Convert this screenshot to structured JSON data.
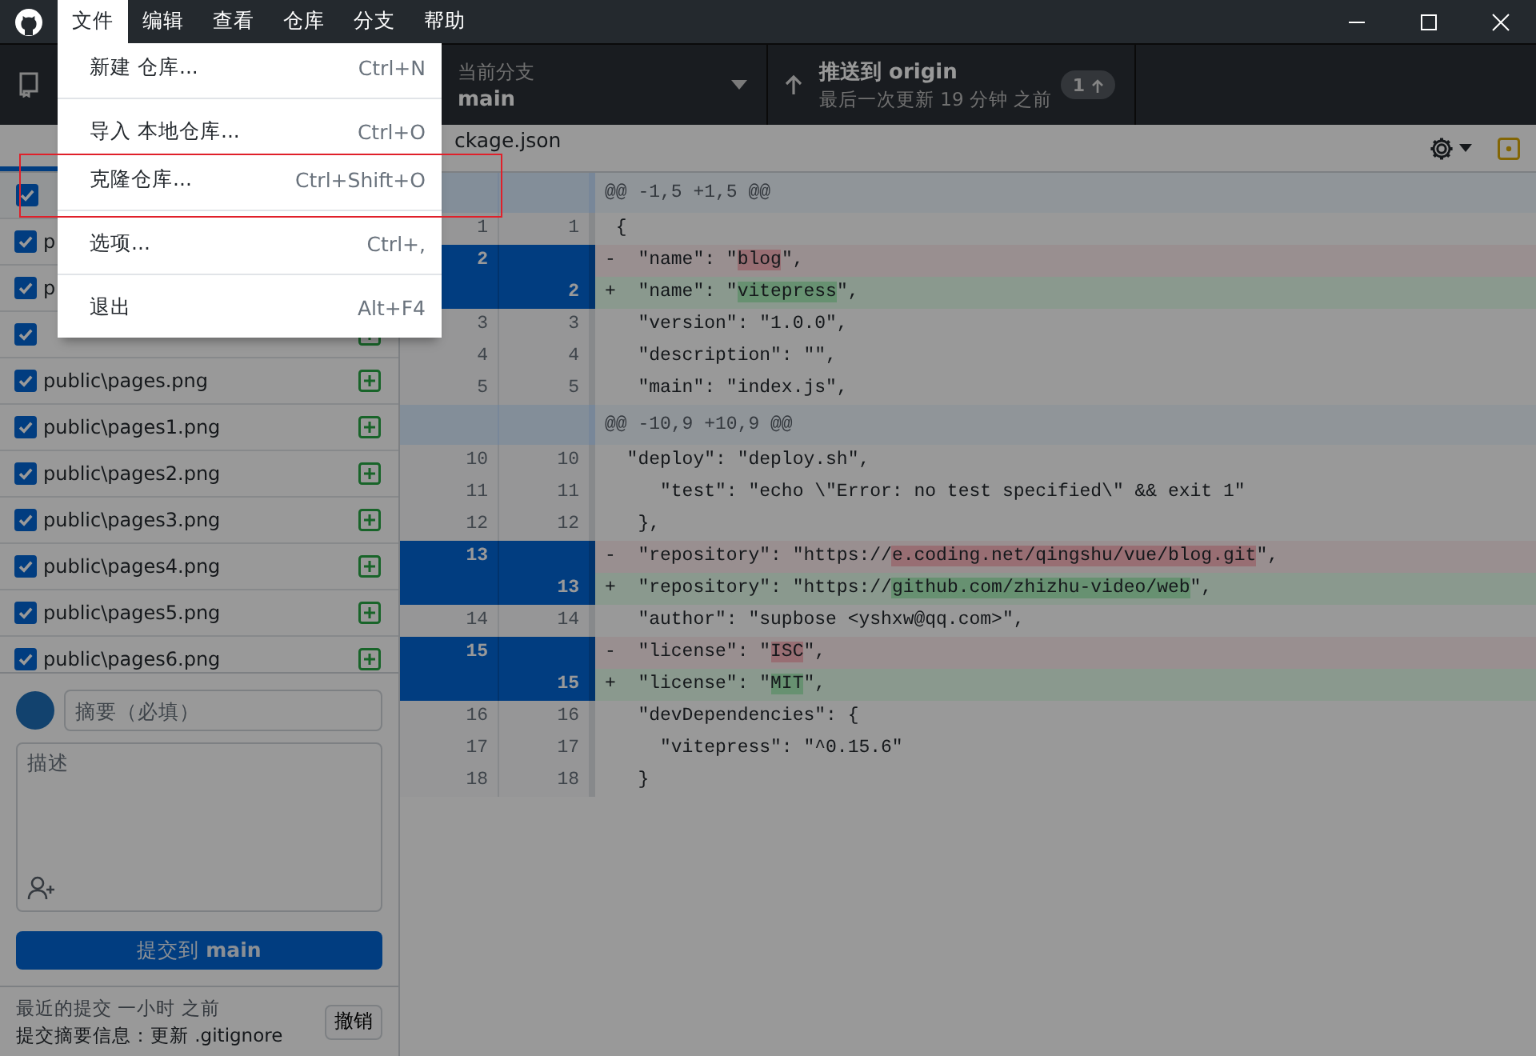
{
  "menubar": [
    {
      "label": "文件",
      "selected": true
    },
    {
      "label": "编辑",
      "selected": false
    },
    {
      "label": "查看",
      "selected": false
    },
    {
      "label": "仓库",
      "selected": false
    },
    {
      "label": "分支",
      "selected": false
    },
    {
      "label": "帮助",
      "selected": false
    }
  ],
  "toolbar": {
    "branch": {
      "label": "当前分支",
      "value": "main"
    },
    "push": {
      "title": "推送到 origin",
      "subtitle": "最后一次更新 19 分钟 之前",
      "badge": "1"
    }
  },
  "changes": {
    "all_checked": true,
    "files": [
      {
        "name": "p",
        "checked": true
      },
      {
        "name": "p",
        "checked": true
      },
      {
        "checked": true,
        "kind": "added"
      },
      {
        "name": "public\\pages.png",
        "checked": true,
        "kind": "added"
      },
      {
        "name": "public\\pages1.png",
        "checked": true,
        "kind": "added"
      },
      {
        "name": "public\\pages2.png",
        "checked": true,
        "kind": "added"
      },
      {
        "name": "public\\pages3.png",
        "checked": true,
        "kind": "added"
      },
      {
        "name": "public\\pages4.png",
        "checked": true,
        "kind": "added"
      },
      {
        "name": "public\\pages5.png",
        "checked": true,
        "kind": "added"
      },
      {
        "name": "public\\pages6.png",
        "checked": true,
        "kind": "added"
      }
    ]
  },
  "commit": {
    "summary_placeholder": "摘要（必填）",
    "description_placeholder": "描述",
    "button": "提交到 **main**"
  },
  "last_commit": {
    "time": "最近的提交 一小时 之前",
    "message": "提交摘要信息：更新 .gitignore",
    "undo": "撤销"
  },
  "diff": {
    "file": "ckage.json",
    "lines": [
      {
        "kind": "hunk",
        "parts": [
          {
            "text": "@@ -1,5 +1,5 @@"
          }
        ]
      },
      {
        "kind": "context",
        "old": "1",
        "new": "1",
        "parts": [
          {
            "text": " {"
          }
        ]
      },
      {
        "kind": "del",
        "old": "2",
        "selected": true,
        "parts": [
          {
            "text": "-  \"name\": \""
          },
          {
            "text": "blog",
            "changed": true
          },
          {
            "text": "\","
          }
        ]
      },
      {
        "kind": "add",
        "new": "2",
        "selected": true,
        "parts": [
          {
            "text": "+  \"name\": \""
          },
          {
            "text": "vitepress",
            "changed": true
          },
          {
            "text": "\","
          }
        ]
      },
      {
        "kind": "context",
        "old": "3",
        "new": "3",
        "parts": [
          {
            "text": "   \"version\": \"1.0.0\","
          }
        ]
      },
      {
        "kind": "context",
        "old": "4",
        "new": "4",
        "parts": [
          {
            "text": "   \"description\": \"\","
          }
        ]
      },
      {
        "kind": "context",
        "old": "5",
        "new": "5",
        "parts": [
          {
            "text": "   \"main\": \"index.js\","
          }
        ]
      },
      {
        "kind": "hunk",
        "parts": [
          {
            "text": "@@ -10,9 +10,9 @@"
          }
        ]
      },
      {
        "kind": "context",
        "old": "10",
        "new": "10",
        "parts": [
          {
            "text": "  \"deploy\": \"deploy.sh\","
          }
        ]
      },
      {
        "kind": "context",
        "old": "11",
        "new": "11",
        "parts": [
          {
            "text": "     \"test\": \"echo \\\"Error: no test specified\\\" && exit 1\""
          }
        ]
      },
      {
        "kind": "context",
        "old": "12",
        "new": "12",
        "parts": [
          {
            "text": "   },"
          }
        ]
      },
      {
        "kind": "del",
        "old": "13",
        "selected": true,
        "parts": [
          {
            "text": "-  \"repository\": \"https://"
          },
          {
            "text": "e.coding.net/qingshu/vue/blog.git",
            "changed": true
          },
          {
            "text": "\","
          }
        ]
      },
      {
        "kind": "add",
        "new": "13",
        "selected": true,
        "parts": [
          {
            "text": "+  \"repository\": \"https://"
          },
          {
            "text": "github.com/zhizhu-video/web",
            "changed": true
          },
          {
            "text": "\","
          }
        ]
      },
      {
        "kind": "context",
        "old": "14",
        "new": "14",
        "parts": [
          {
            "text": "   \"author\": \"supbose <yshxw@qq.com>\","
          }
        ]
      },
      {
        "kind": "del",
        "old": "15",
        "selected": true,
        "parts": [
          {
            "text": "-  \"license\": \""
          },
          {
            "text": "ISC",
            "changed": true
          },
          {
            "text": "\","
          }
        ]
      },
      {
        "kind": "add",
        "new": "15",
        "selected": true,
        "parts": [
          {
            "text": "+  \"license\": \""
          },
          {
            "text": "MIT",
            "changed": true
          },
          {
            "text": "\","
          }
        ]
      },
      {
        "kind": "context",
        "old": "16",
        "new": "16",
        "parts": [
          {
            "text": "   \"devDependencies\": {"
          }
        ]
      },
      {
        "kind": "context",
        "old": "17",
        "new": "17",
        "parts": [
          {
            "text": "     \"vitepress\": \"^0.15.6\""
          }
        ]
      },
      {
        "kind": "context",
        "old": "18",
        "new": "18",
        "parts": [
          {
            "text": "   }"
          }
        ]
      }
    ]
  },
  "file_menu": {
    "groups": [
      [
        {
          "label": "新建 仓库...",
          "shortcut": "Ctrl+N",
          "highlighted": false
        }
      ],
      [
        {
          "label": "导入 本地仓库...",
          "shortcut": "Ctrl+O",
          "highlighted": false
        },
        {
          "label": "克隆仓库...",
          "shortcut": "Ctrl+Shift+O",
          "highlighted": true
        }
      ],
      [
        {
          "label": "选项...",
          "shortcut": "Ctrl+,",
          "highlighted": false
        }
      ],
      [
        {
          "label": "退出",
          "shortcut": "Alt+F4",
          "highlighted": false
        }
      ]
    ]
  }
}
